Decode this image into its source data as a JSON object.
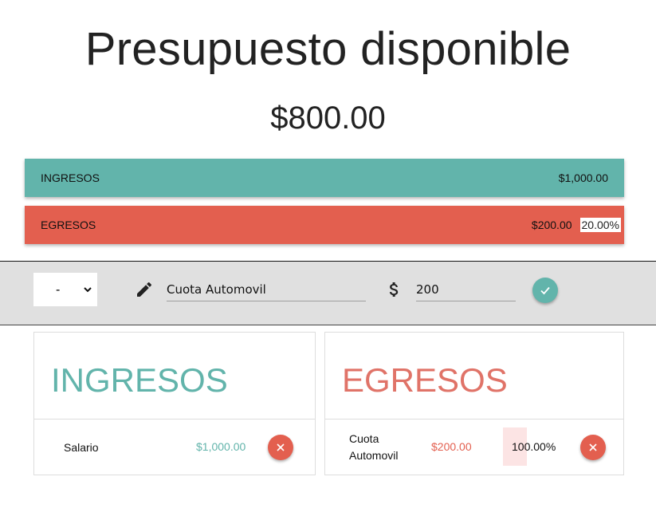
{
  "header": {
    "title": "Presupuesto disponible",
    "total": "$800.00"
  },
  "summary": {
    "income": {
      "label": "INGRESOS",
      "amount": "$1,000.00",
      "color": "#62b4ab"
    },
    "expense": {
      "label": "EGRESOS",
      "amount": "$200.00",
      "percent": "20.00%",
      "color": "#e35f4f"
    }
  },
  "form": {
    "type_selected": "-",
    "type_options": [
      "-"
    ],
    "description_value": "Cuota Automovil",
    "amount_value": "200",
    "icons": {
      "description": "pencil-icon",
      "amount": "dollar-icon",
      "submit": "check-icon"
    }
  },
  "income_panel": {
    "title": "INGRESOS",
    "items": [
      {
        "description": "Salario",
        "amount": "$1,000.00"
      }
    ]
  },
  "expense_panel": {
    "title": "EGRESOS",
    "items": [
      {
        "description": "Cuota Automovil",
        "amount": "$200.00",
        "percent": "100.00%"
      }
    ]
  }
}
